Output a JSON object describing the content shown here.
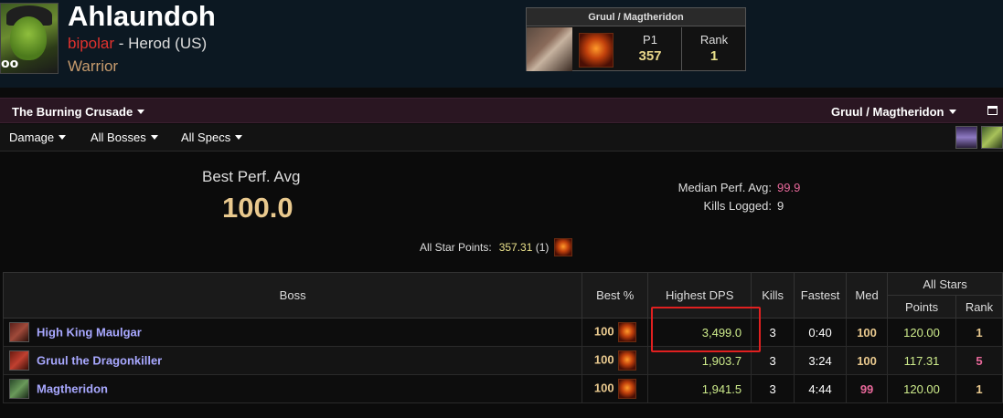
{
  "character": {
    "name": "Ahlaundoh",
    "guild": "bipolar",
    "realm_sep": " - ",
    "realm": "Herod (US)",
    "class": "Warrior",
    "avatar_level_text": "oo"
  },
  "zone_box": {
    "title": "Gruul / Magtheridon",
    "p1_label": "P1",
    "p1_value": "357",
    "rank_label": "Rank",
    "rank_value": "1"
  },
  "toolbar": {
    "expansion": "The Burning Crusade",
    "zone": "Gruul / Magtheridon",
    "metric": "Damage",
    "bosses": "All Bosses",
    "specs": "All Specs"
  },
  "summary": {
    "best_label": "Best Perf. Avg",
    "best_value": "100.0",
    "median_label": "Median Perf. Avg:",
    "median_value": "99.9",
    "kills_label": "Kills Logged:",
    "kills_value": "9",
    "stars_label": "All Star Points:",
    "stars_value": "357.31",
    "stars_rank": "(1)"
  },
  "table": {
    "headers": {
      "boss": "Boss",
      "best_pct": "Best %",
      "highest_dps": "Highest DPS",
      "kills": "Kills",
      "fastest": "Fastest",
      "med": "Med",
      "all_stars": "All Stars",
      "points": "Points",
      "rank": "Rank"
    },
    "rows": [
      {
        "boss": "High King Maulgar",
        "best": "100",
        "dps": "3,499.0",
        "kills": "3",
        "fastest": "0:40",
        "med": "100",
        "points": "120.00",
        "rank": "1"
      },
      {
        "boss": "Gruul the Dragonkiller",
        "best": "100",
        "dps": "1,903.7",
        "kills": "3",
        "fastest": "3:24",
        "med": "100",
        "points": "117.31",
        "rank": "5"
      },
      {
        "boss": "Magtheridon",
        "best": "100",
        "dps": "1,941.5",
        "kills": "3",
        "fastest": "4:44",
        "med": "99",
        "points": "120.00",
        "rank": "1"
      }
    ]
  },
  "colors": {
    "med_100": "#e9c98e",
    "med_99": "#e8689a",
    "rank_1": "#e9c98e",
    "rank_5": "#e8689a",
    "median_value": "#e8689a",
    "highlight_box": "#e02020"
  }
}
